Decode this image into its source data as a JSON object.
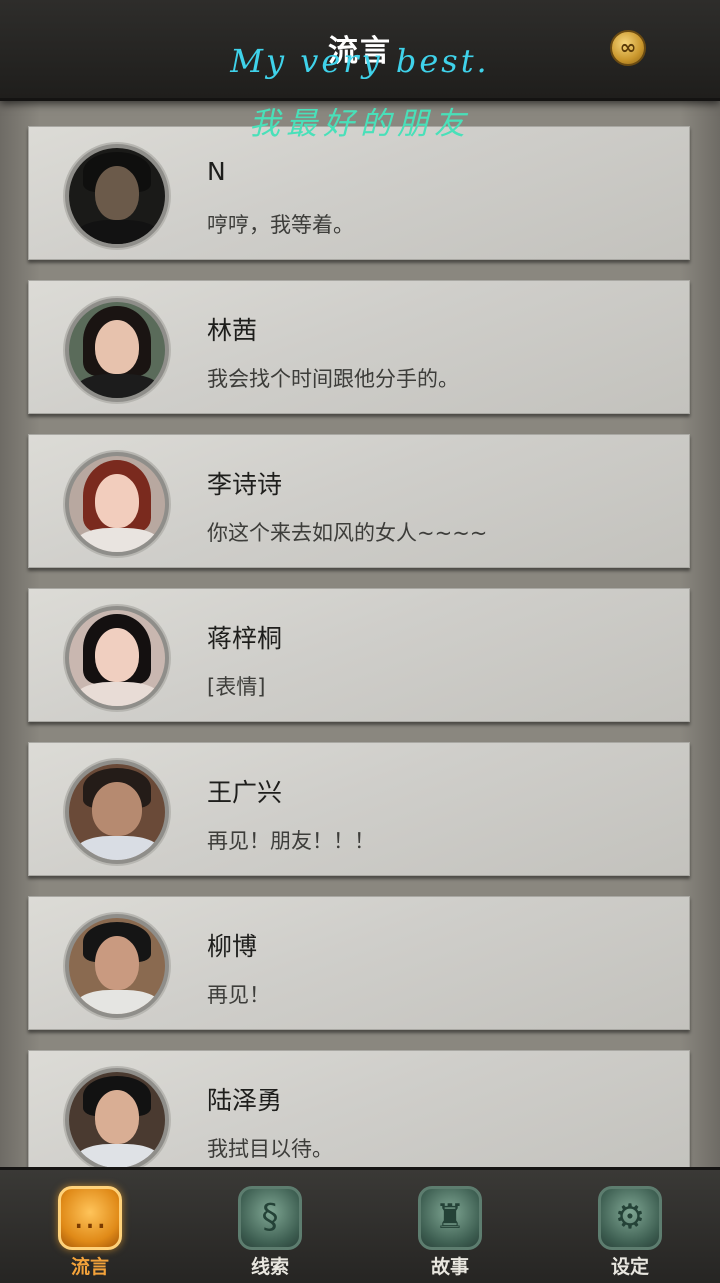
{
  "header": {
    "title": "流言",
    "coin_icon": "infinity-coin-icon",
    "coin_glyph": "∞"
  },
  "watermark": {
    "line1": "My very best.",
    "line2": "我最好的朋友",
    "color1": "#3fd2ea",
    "color2": "#49e0b9"
  },
  "contacts": [
    {
      "name": "N",
      "message": "哼哼，我等着。"
    },
    {
      "name": "林茜",
      "message": "我会找个时间跟他分手的。"
    },
    {
      "name": "李诗诗",
      "message": "你这个来去如风的女人~~~~"
    },
    {
      "name": "蒋梓桐",
      "message": "[表情]"
    },
    {
      "name": "王广兴",
      "message": "再见！朋友！！！"
    },
    {
      "name": "柳博",
      "message": "再见！"
    },
    {
      "name": "陆泽勇",
      "message": "我拭目以待。"
    }
  ],
  "bottom_nav": [
    {
      "label": "流言",
      "icon": "chat-bubble-icon",
      "glyph": "…",
      "active": true
    },
    {
      "label": "线索",
      "icon": "scroll-icon",
      "glyph": "§",
      "active": false
    },
    {
      "label": "故事",
      "icon": "castle-icon",
      "glyph": "♜",
      "active": false
    },
    {
      "label": "设定",
      "icon": "gear-icon",
      "glyph": "⚙",
      "active": false
    }
  ],
  "colors": {
    "active_tab": "#f3a23a",
    "inactive_icon": "#3e5f52",
    "header_bg": "#1f1e1c"
  }
}
